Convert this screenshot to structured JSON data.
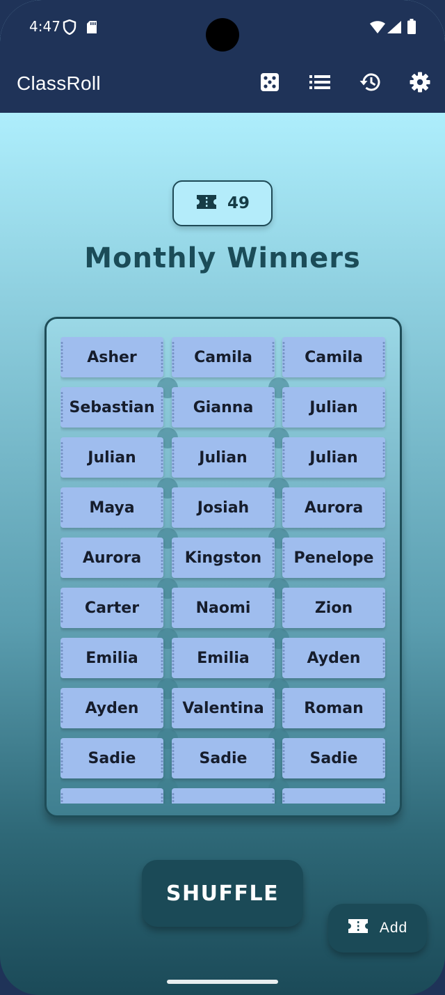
{
  "status_bar": {
    "time": "4:47",
    "icons": [
      "shield-icon",
      "sd-card-icon",
      "wifi-icon",
      "signal-icon",
      "battery-icon"
    ]
  },
  "app_bar": {
    "title": "ClassRoll",
    "actions": [
      "dice-icon",
      "list-icon",
      "history-icon",
      "settings-icon"
    ]
  },
  "badge": {
    "icon": "ticket-icon",
    "count": "49"
  },
  "heading": "Monthly Winners",
  "tickets": [
    "Asher",
    "Camila",
    "Camila",
    "Sebastian",
    "Gianna",
    "Julian",
    "Julian",
    "Julian",
    "Julian",
    "Maya",
    "Josiah",
    "Aurora",
    "Aurora",
    "Kingston",
    "Penelope",
    "Carter",
    "Naomi",
    "Zion",
    "Emilia",
    "Emilia",
    "Ayden",
    "Ayden",
    "Valentina",
    "Roman",
    "Sadie",
    "Sadie",
    "Sadie"
  ],
  "shuffle_label": "SHUFFLE",
  "fab": {
    "icon": "ticket-icon",
    "label": "Add"
  },
  "colors": {
    "app_bar": "#1f3358",
    "ticket": "#9fbdee",
    "accent_dark": "#1b4a57",
    "heading": "#1b4c58"
  }
}
